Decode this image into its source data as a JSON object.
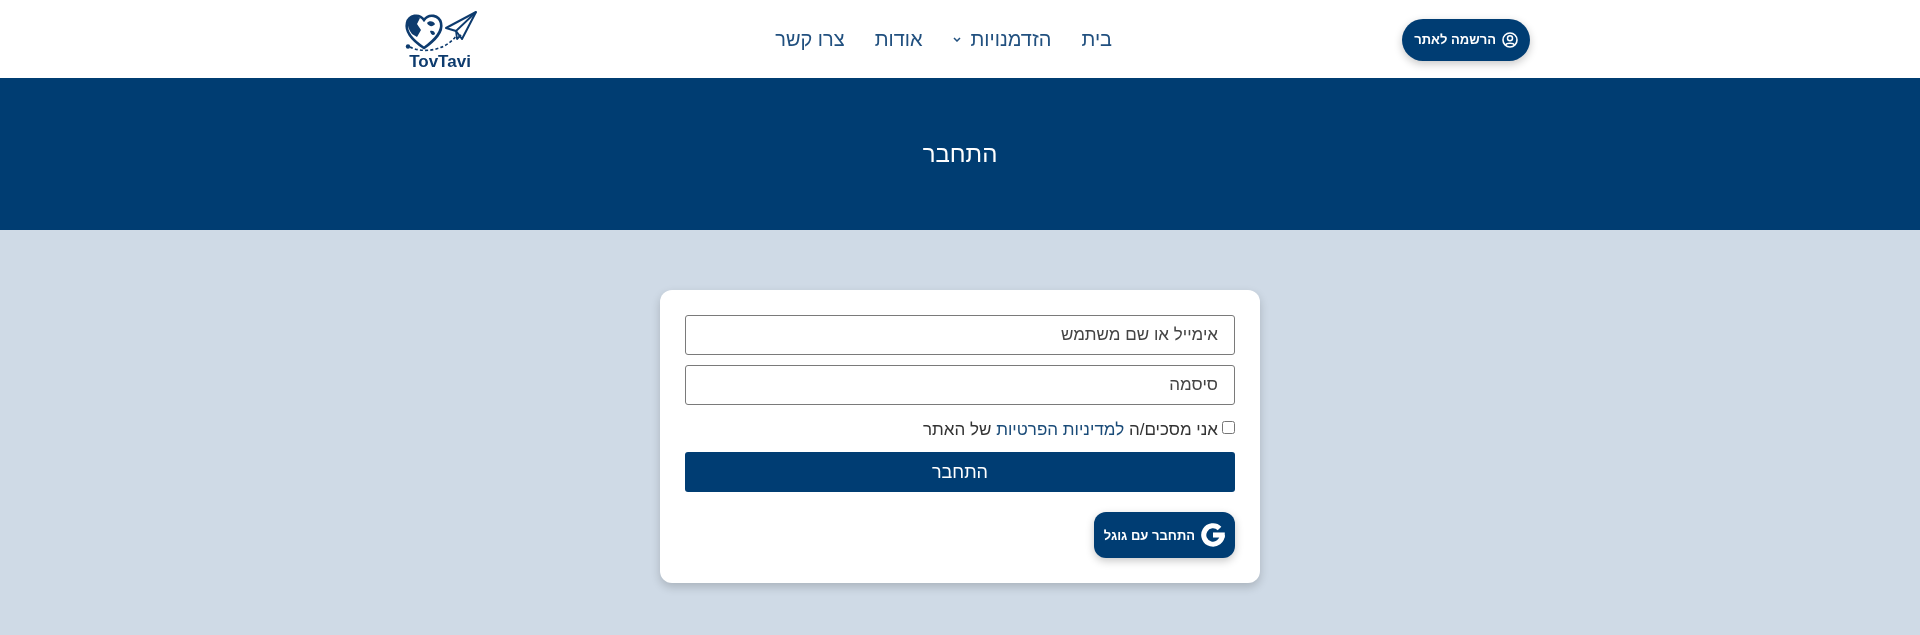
{
  "header": {
    "logo": {
      "text": "TovTavi"
    },
    "nav": [
      {
        "label": "בית",
        "dropdown": false
      },
      {
        "label": "הזדמנויות",
        "dropdown": true
      },
      {
        "label": "אודות",
        "dropdown": false
      },
      {
        "label": "צרו קשר",
        "dropdown": false
      }
    ],
    "register_button": {
      "label": "הרשמה לאתר"
    }
  },
  "hero": {
    "title": "התחבר"
  },
  "login_form": {
    "email_field": {
      "placeholder": "אימייל או שם משתמש"
    },
    "password_field": {
      "placeholder": "סיסמה"
    },
    "agreement": {
      "checked": false,
      "text_before": "אני מסכים/ה",
      "link": "למדיניות הפרטיות",
      "text_after": "של האתר"
    },
    "submit_button": {
      "label": "התחבר"
    },
    "google_button": {
      "label": "התחבר עם גוגל"
    }
  }
}
